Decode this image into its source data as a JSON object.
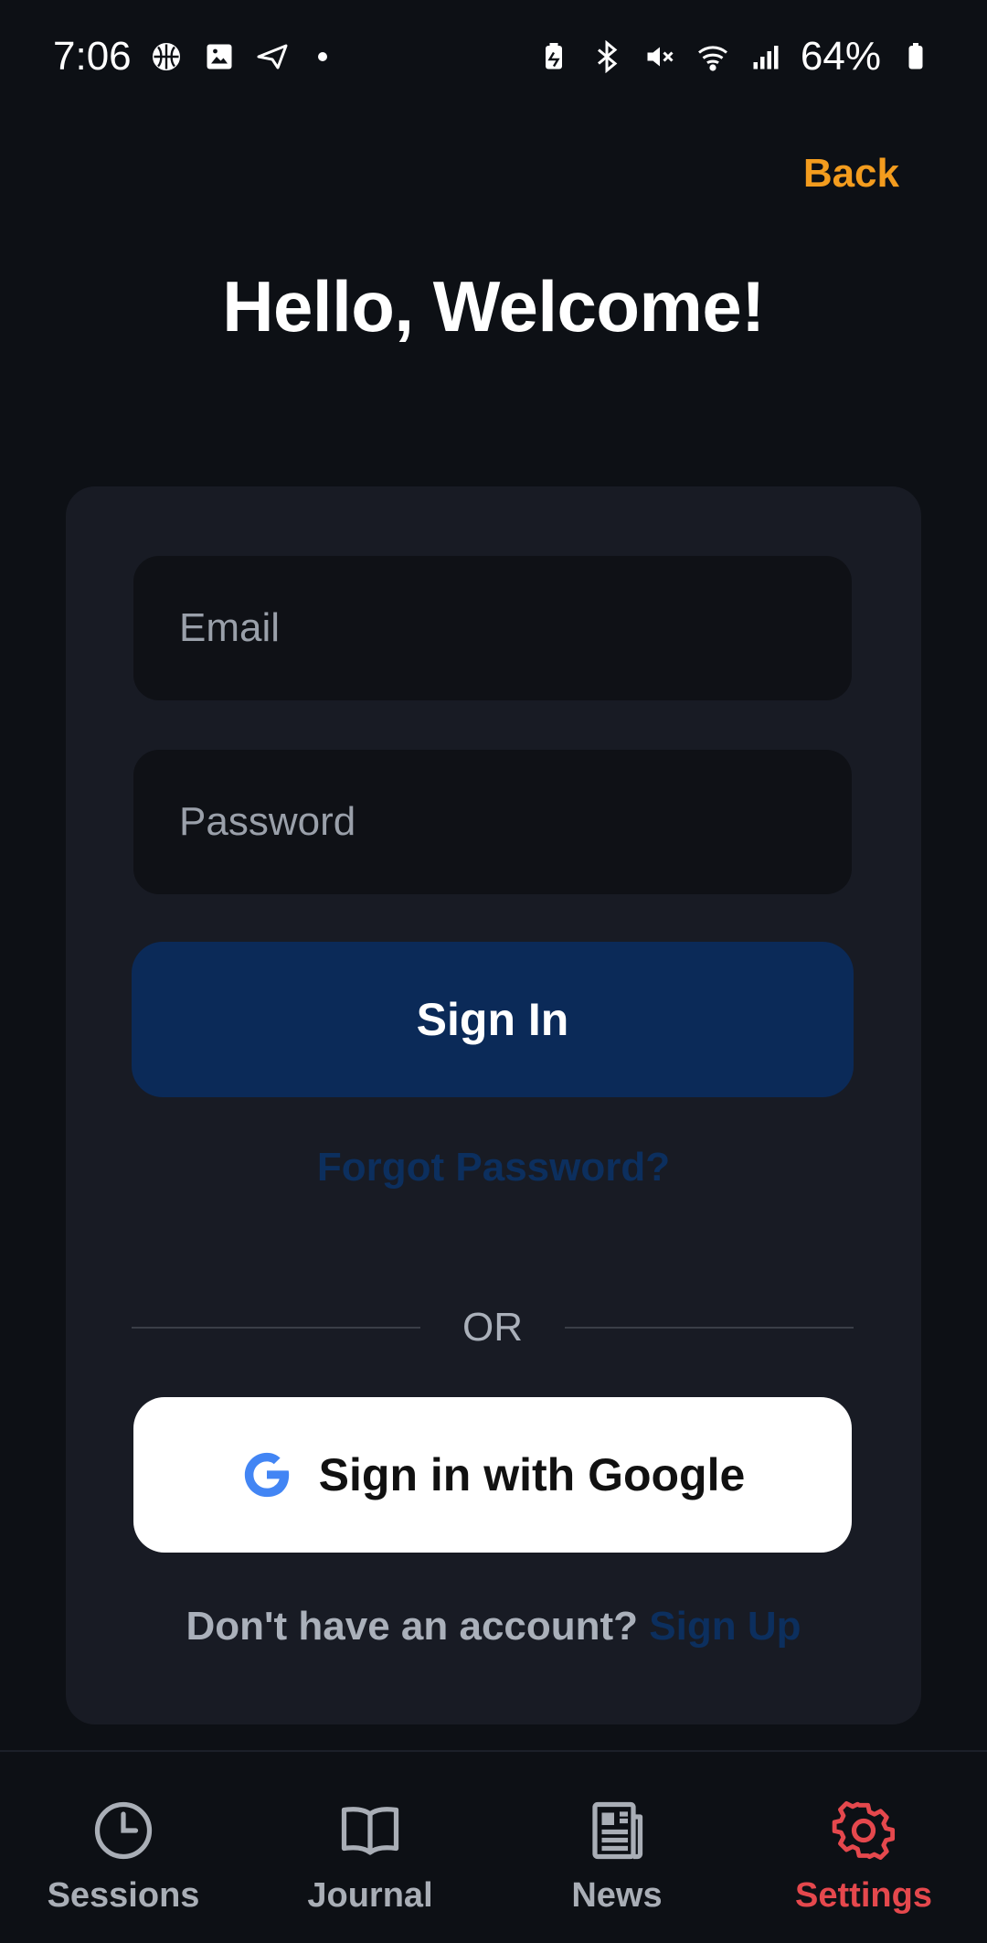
{
  "status_bar": {
    "time": "7:06",
    "battery": "64%",
    "icons_left": [
      "basketball-icon",
      "image-icon",
      "send-icon",
      "dot-icon"
    ],
    "icons_right": [
      "battery-saver-icon",
      "bluetooth-icon",
      "mute-icon",
      "wifi-icon",
      "signal-icon",
      "battery-icon"
    ]
  },
  "header": {
    "back_label": "Back",
    "title": "Hello, Welcome!"
  },
  "form": {
    "email_placeholder": "Email",
    "email_value": "",
    "password_placeholder": "Password",
    "password_value": "",
    "signin_label": "Sign In",
    "forgot_label": "Forgot Password?",
    "or_label": "OR",
    "google_label": "Sign in with Google",
    "signup_prompt": "Don't have an account?",
    "signup_link": "Sign Up"
  },
  "nav": {
    "items": [
      {
        "label": "Sessions",
        "icon": "clock-icon",
        "active": false
      },
      {
        "label": "Journal",
        "icon": "book-icon",
        "active": false
      },
      {
        "label": "News",
        "icon": "newspaper-icon",
        "active": false
      },
      {
        "label": "Settings",
        "icon": "gear-icon",
        "active": true
      }
    ]
  },
  "colors": {
    "background": "#0d1015",
    "card": "#181b24",
    "accent_back": "#f39c1e",
    "primary_button": "#0b2a58",
    "link": "#0c2f5e",
    "active_nav": "#e5484d"
  }
}
